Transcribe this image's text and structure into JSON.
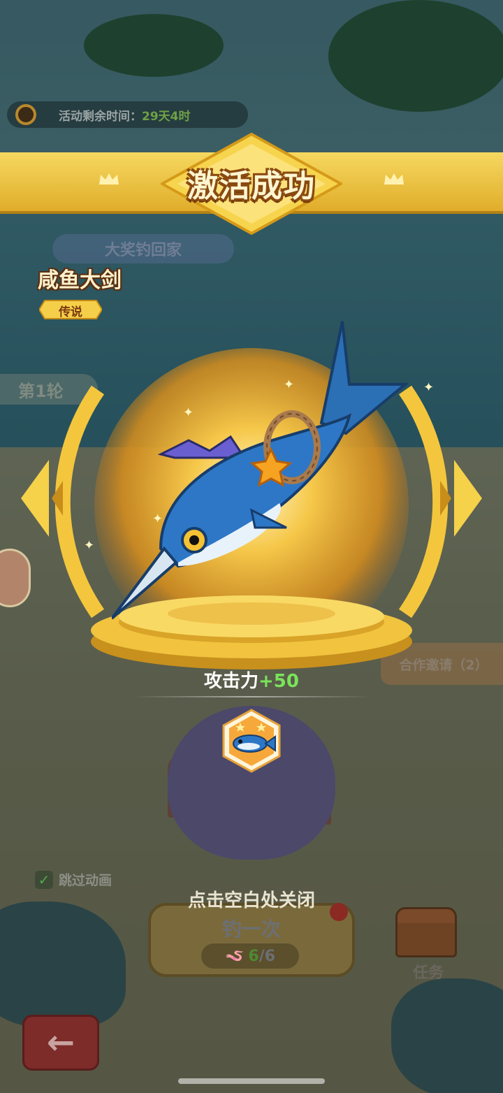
{
  "popup": {
    "title": "激活成功",
    "item_name": "咸鱼大剑",
    "rarity": "传说",
    "stat_label": "攻击力",
    "stat_value": "+50",
    "close_hint": "点击空白处关闭",
    "badge_icon": "fish-badge-icon",
    "item_icon": "marlin-sword-icon"
  },
  "background": {
    "event_timer_label": "活动剩余时间：",
    "event_timer_value": "29天4时",
    "prize_banner": "大奖钓回家",
    "round_label": "第1轮",
    "invite_button": "合作邀请（2）",
    "skip_animation_label": "跳过动画",
    "skip_animation_checked": true,
    "fish_button": {
      "label": "钓一次",
      "current": "6",
      "max": "/6"
    },
    "task_button": "任务",
    "back_icon": "arrow-left-icon"
  },
  "colors": {
    "gold": "#f2c53d",
    "gold_dark": "#c88a14",
    "stat_plus": "#7be35a",
    "overlay": "rgba(10,30,40,0.62)"
  }
}
